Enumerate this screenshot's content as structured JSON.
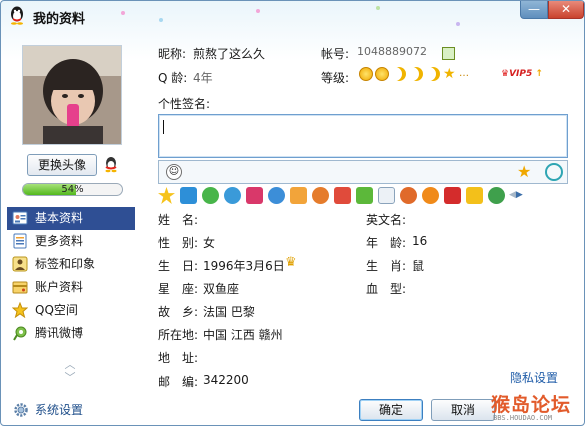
{
  "window": {
    "title": "我的资料",
    "minimize_label": "—",
    "close_label": "✕"
  },
  "left": {
    "change_avatar_label": "更换头像",
    "progress": {
      "value": 0.54,
      "text": "54%"
    },
    "nav": [
      {
        "label": "基本资料",
        "icon": "basic-info-icon",
        "active": true
      },
      {
        "label": "更多资料",
        "icon": "more-info-icon",
        "active": false
      },
      {
        "label": "标签和印象",
        "icon": "tags-icon",
        "active": false
      },
      {
        "label": "账户资料",
        "icon": "account-icon",
        "active": false
      },
      {
        "label": "QQ空间",
        "icon": "qzone-star-icon",
        "active": false
      },
      {
        "label": "腾讯微博",
        "icon": "weibo-icon",
        "active": false
      }
    ],
    "system_settings_label": "系统设置"
  },
  "profile": {
    "nickname_label": "昵称:",
    "nickname": "煎熬了这么久",
    "account_label": "帐号:",
    "account": "1048889072",
    "qage_label": "Q 龄:",
    "qage": "4年",
    "level_label": "等级:",
    "vip_text": "VIP5",
    "signature_label": "个性签名:",
    "signature_value": ""
  },
  "basic": {
    "name_label": "姓　名:",
    "name": "",
    "english_name_label": "英文名:",
    "english_name": "",
    "gender_label": "性　别:",
    "gender": "女",
    "age_label": "年　龄:",
    "age": "16",
    "birthday_label": "生　日:",
    "birthday": "1996年3月6日",
    "zodiac_label": "生　肖:",
    "zodiac": "鼠",
    "constellation_label": "星　座:",
    "constellation": "双鱼座",
    "blood_label": "血　型:",
    "blood": "",
    "hometown_label": "故　乡:",
    "hometown": "法国 巴黎",
    "location_label": "所在地:",
    "location": "中国 江西 赣州",
    "address_label": "地　址:",
    "address": "",
    "postcode_label": "邮　编:",
    "postcode": "342200"
  },
  "footer": {
    "privacy_link": "隐私设置",
    "ok_label": "确定",
    "cancel_label": "取消",
    "watermark_main": "猴岛论坛",
    "watermark_sub": "BBS.HOUDAO.COM"
  },
  "colors": {
    "active_nav": "#2f4f94",
    "link": "#1f5ca8",
    "progress": "#52b81e"
  }
}
